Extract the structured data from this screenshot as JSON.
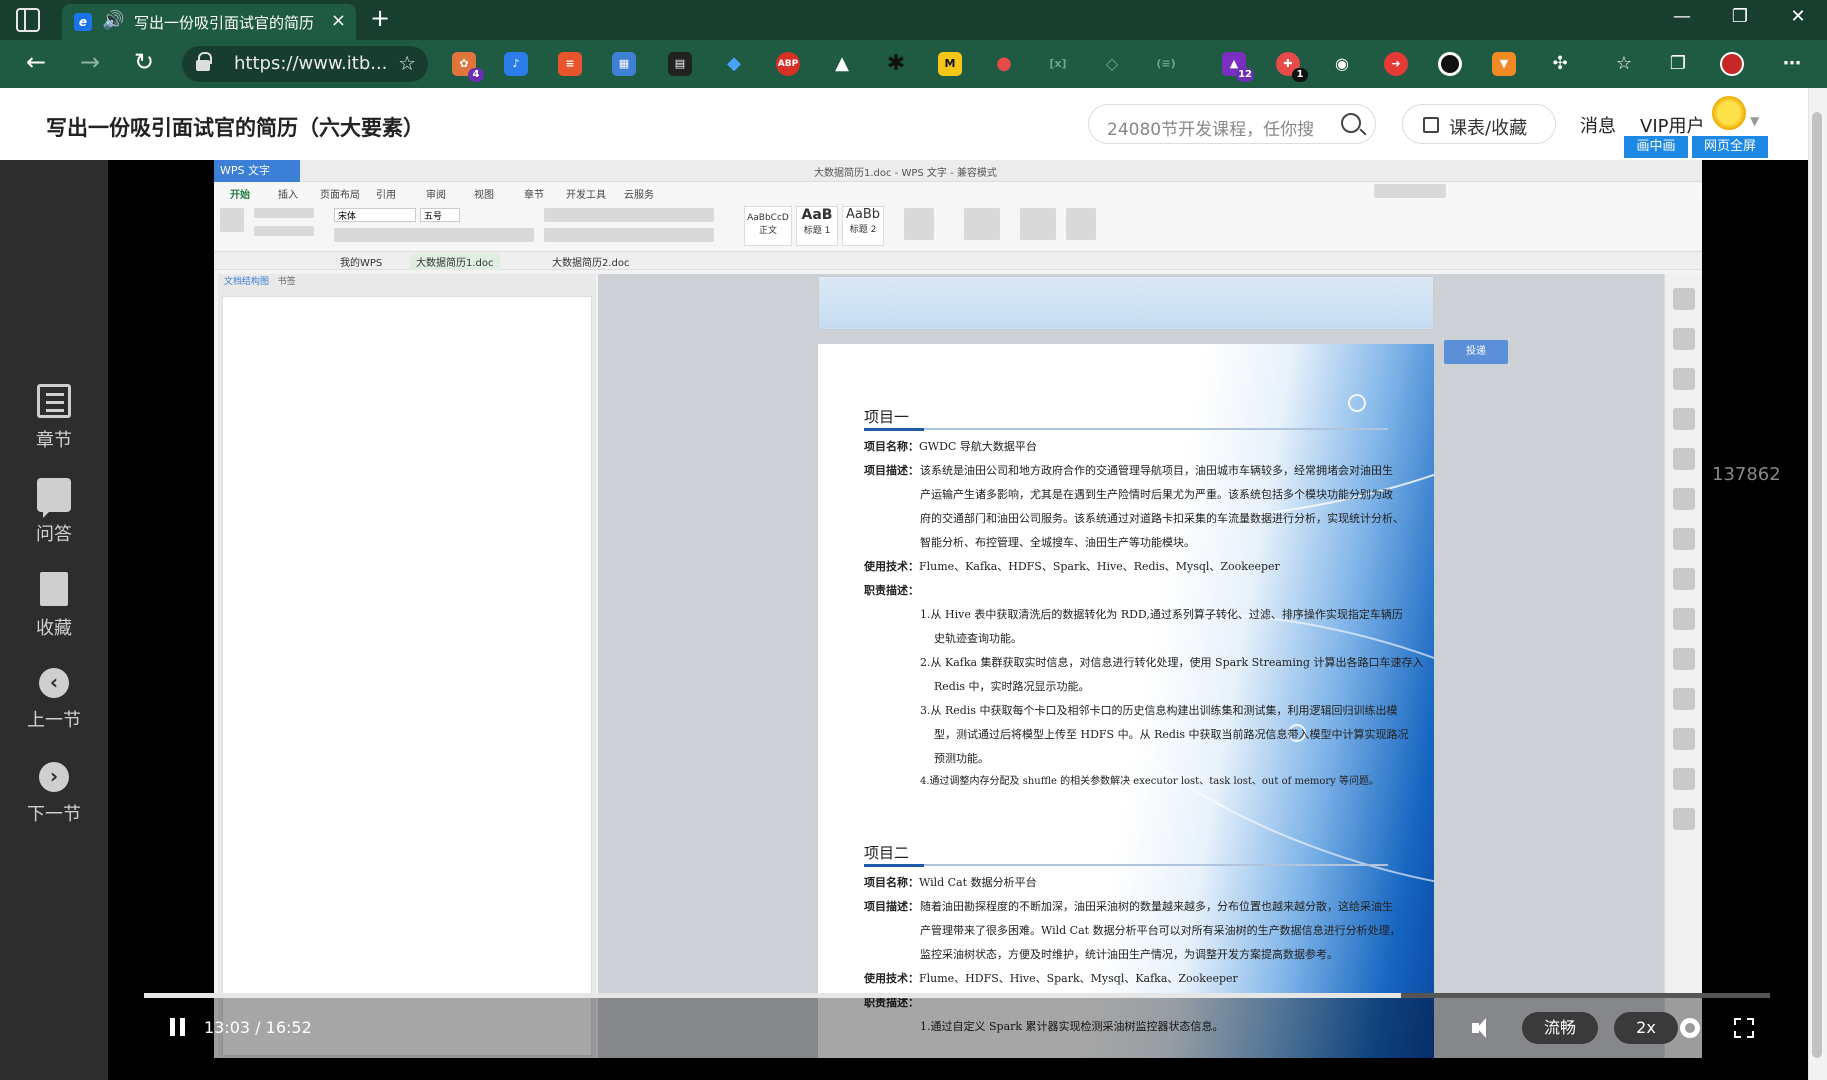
{
  "browser": {
    "tab_title": "写出一份吸引面试官的简历",
    "url": "https://www.itb...",
    "extension_badges": {
      "first": "4",
      "purple": "12",
      "red": "1"
    },
    "ext_labels": {
      "abp": "ABP",
      "m": "M"
    },
    "window_controls": {
      "minimize": "—",
      "maximize": "❐",
      "close": "✕"
    }
  },
  "header": {
    "course_title": "写出一份吸引面试官的简历（六大要素）",
    "search_placeholder": "24080节开发课程，任你搜",
    "list_button": "课表/收藏",
    "messages": "消息",
    "vip": "VIP用户",
    "pip_button": "画中画",
    "webfull_button": "网页全屏"
  },
  "left_nav": {
    "chapter": "章节",
    "qa": "问答",
    "favorite": "收藏",
    "prev": "上一节",
    "next": "下一节"
  },
  "wps": {
    "logo": "WPS 文字",
    "doc_title": "大数据简历1.doc - WPS 文字 - 兼容模式",
    "menu": [
      "开始",
      "插入",
      "页面布局",
      "引用",
      "审阅",
      "视图",
      "章节",
      "开发工具",
      "云服务"
    ],
    "font": "宋体",
    "size": "五号",
    "styles": [
      {
        "sample": "AaBbCcD",
        "name": "正文"
      },
      {
        "sample": "AaB",
        "name": "标题 1"
      },
      {
        "sample": "AaBb",
        "name": "标题 2"
      }
    ],
    "tabs": {
      "home": "我的WPS",
      "doc1": "大数据简历1.doc",
      "doc2": "大数据简历2.doc"
    },
    "nav_pane": {
      "tab1": "文档结构图",
      "tab2": "书签"
    },
    "touf": "投递"
  },
  "resume": {
    "p1_heading": "项目一",
    "p1_name_label": "项目名称：",
    "p1_name": "GWDC 导航大数据平台",
    "p1_desc_label": "项目描述：",
    "p1_desc": [
      "该系统是油田公司和地方政府合作的交通管理导航项目，油田城市车辆较多，经常拥堵会对油田生",
      "产运输产生诸多影响，尤其是在遇到生产险情时后果尤为严重。该系统包括多个模块功能分别为政",
      "府的交通部门和油田公司服务。该系统通过对道路卡扣采集的车流量数据进行分析，实现统计分析、",
      "智能分析、布控管理、全城搜车、油田生产等功能模块。"
    ],
    "p1_tech_label": "使用技术：",
    "p1_tech": "Flume、Kafka、HDFS、Spark、Hive、Redis、Mysql、Zookeeper",
    "p1_duty_label": "职责描述：",
    "p1_duties": [
      "1.从 Hive 表中获取清洗后的数据转化为 RDD,通过系列算子转化、过滤、排序操作实现指定车辆历",
      "史轨迹查询功能。",
      "2.从 Kafka 集群获取实时信息，对信息进行转化处理，使用 Spark Streaming 计算出各路口车速存入",
      "Redis 中，实时路况显示功能。",
      "3.从 Redis 中获取每个卡口及相邻卡口的历史信息构建出训练集和测试集，利用逻辑回归训练出模",
      "型，测试通过后将模型上传至 HDFS 中。从 Redis 中获取当前路况信息带入模型中计算实现路况",
      "预测功能。",
      "4.通过调整内存分配及 shuffle 的相关参数解决 executor lost、task lost、out of memory 等问题。"
    ],
    "p2_heading": "项目二",
    "p2_name_label": "项目名称：",
    "p2_name": "Wild Cat 数据分析平台",
    "p2_desc_label": "项目描述：",
    "p2_desc": [
      "随着油田勘探程度的不断加深，油田采油树的数量越来越多，分布位置也越来越分散，这给采油生",
      "产管理带来了很多困难。Wild Cat 数据分析平台可以对所有采油树的生产数据信息进行分析处理，",
      "监控采油树状态，方便及时维护，统计油田生产情况，为调整开发方案提高数据参考。"
    ],
    "p2_tech_label": "使用技术：",
    "p2_tech": "Flume、HDFS、Hive、Spark、Mysql、Kafka、Zookeeper",
    "p2_duty_label": "职责描述：",
    "p2_duty_1": "1.通过自定义 Spark 累计器实现检测采油树监控器状态信息。"
  },
  "side_number": "137862",
  "player": {
    "time": "13:03 / 16:52",
    "progress": 0.7733,
    "quality": "流畅",
    "speed": "2x"
  }
}
